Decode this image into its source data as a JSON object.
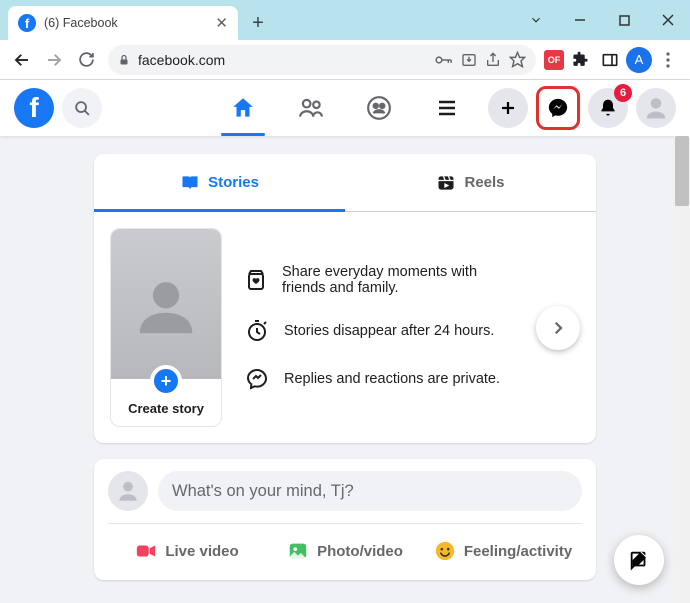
{
  "browser": {
    "tab_title": "(6) Facebook",
    "url": "facebook.com",
    "profile_letter": "A",
    "ext_badge": "OF"
  },
  "fb_header": {
    "notifications_badge": "6"
  },
  "stories_card": {
    "tabs": {
      "stories": "Stories",
      "reels": "Reels"
    },
    "create_label": "Create story",
    "hint1": "Share everyday moments with friends and family.",
    "hint2": "Stories disappear after 24 hours.",
    "hint3": "Replies and reactions are private."
  },
  "composer": {
    "placeholder": "What's on your mind, Tj?",
    "live": "Live video",
    "photo": "Photo/video",
    "feeling": "Feeling/activity"
  }
}
